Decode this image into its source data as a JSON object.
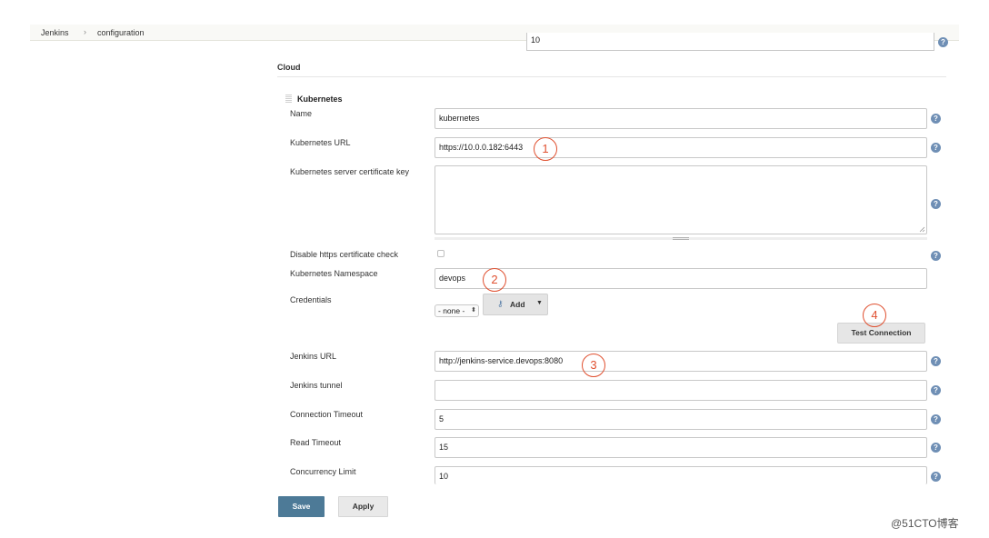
{
  "breadcrumb": {
    "items": [
      "Jenkins",
      "configuration"
    ],
    "separator": "›"
  },
  "top_field": {
    "value": "10"
  },
  "cloud": {
    "section_title": "Cloud",
    "kubernetes_title": "Kubernetes",
    "fields": {
      "name": {
        "label": "Name",
        "value": "kubernetes"
      },
      "kubernetes_url": {
        "label": "Kubernetes URL",
        "value": "https://10.0.0.182:6443"
      },
      "server_cert_key": {
        "label": "Kubernetes server certificate key",
        "value": ""
      },
      "disable_https_check": {
        "label": "Disable https certificate check",
        "checked": false
      },
      "namespace": {
        "label": "Kubernetes Namespace",
        "value": "devops"
      },
      "credentials": {
        "label": "Credentials",
        "selected": "- none -",
        "add_label": "Add"
      },
      "jenkins_url": {
        "label": "Jenkins URL",
        "value": "http://jenkins-service.devops:8080"
      },
      "jenkins_tunnel": {
        "label": "Jenkins tunnel",
        "value": ""
      },
      "connection_timeout": {
        "label": "Connection Timeout",
        "value": "5"
      },
      "read_timeout": {
        "label": "Read Timeout",
        "value": "15"
      },
      "concurrency_limit": {
        "label": "Concurrency Limit",
        "value": "10"
      }
    },
    "test_connection_label": "Test Connection"
  },
  "help_icon_glyph": "?",
  "markers": [
    "1",
    "2",
    "3",
    "4"
  ],
  "buttons": {
    "save": "Save",
    "apply": "Apply"
  },
  "watermark": "@51CTO博客",
  "colors": {
    "save_button": "#4d7a97",
    "help_icon": "#6f8fb5",
    "annotation_marker": "#e05030"
  },
  "icons": {
    "help": "help-icon",
    "key": "key-icon",
    "dropdown": "caret-down-icon",
    "drag_handle": "drag-handle-icon"
  }
}
